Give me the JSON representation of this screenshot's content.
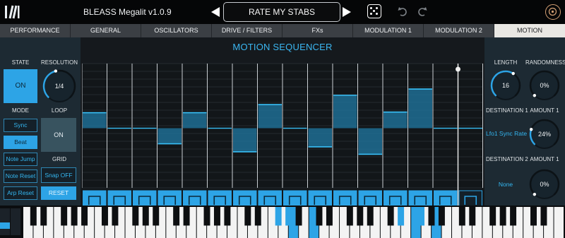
{
  "app": {
    "title": "BLEASS Megalit  v1.0.9",
    "preset_name": "RATE MY STABS"
  },
  "tabs": [
    {
      "label": "PERFORMANCE",
      "active": false
    },
    {
      "label": "GENERAL",
      "active": false
    },
    {
      "label": "OSCILLATORS",
      "active": false
    },
    {
      "label": "DRIVE / FILTERS",
      "active": false
    },
    {
      "label": "FXs",
      "active": false
    },
    {
      "label": "MODULATION 1",
      "active": false
    },
    {
      "label": "MODULATION 2",
      "active": false
    },
    {
      "label": "MOTION",
      "active": true
    }
  ],
  "left": {
    "state_label": "STATE",
    "state_value": "ON",
    "resolution_label": "RESOLUTION",
    "resolution_value": "1/4",
    "resolution_level": 0.45,
    "mode_label": "MODE",
    "modes": [
      {
        "label": "Sync",
        "selected": false
      },
      {
        "label": "Beat",
        "selected": true
      },
      {
        "label": "Note Jump",
        "selected": false
      },
      {
        "label": "Note Reset",
        "selected": false
      },
      {
        "label": "Arp Reset",
        "selected": false
      }
    ],
    "loop_label": "LOOP",
    "loop_value": "ON",
    "grid_label": "GRID",
    "snap_label": "Snap OFF",
    "reset_label": "RESET"
  },
  "sequencer": {
    "title": "MOTION SEQUENCER",
    "steps": [
      0.25,
      0.0,
      0.0,
      -0.25,
      0.25,
      0.0,
      -0.38,
      0.38,
      0.0,
      -0.3,
      0.53,
      -0.42,
      0.26,
      0.63,
      0.0,
      0.0
    ],
    "step_buttons_active": [
      true,
      true,
      true,
      true,
      true,
      true,
      true,
      true,
      true,
      true,
      true,
      true,
      true,
      true,
      true,
      false
    ]
  },
  "right": {
    "length_label": "LENGTH",
    "length_value": "16",
    "length_level": 0.62,
    "randomness_label": "RANDOMNESS",
    "randomness_value": "0%",
    "randomness_level": 0.0,
    "dest1_label": "DESTINATION 1",
    "dest1_value": "Lfo1 Sync Rate",
    "amount1_label": "AMOUNT 1",
    "amount1_value": "24%",
    "amount1_level": 0.24,
    "dest2_label": "DESTINATION 2",
    "dest2_value": "None",
    "amount2_label": "AMOUNT 1",
    "amount2_value": "0%",
    "amount2_level": 0.0
  },
  "colors": {
    "accent": "#2da4e6",
    "accent_text": "#34b6f0",
    "panel": "#1d2a33",
    "tab_bar": "#3b3f44",
    "active_tab": "#e9e7e3"
  },
  "keyboard": {
    "highlighted_white_keys": [
      26,
      28,
      38,
      40
    ],
    "highlighted_black_keys": [
      17,
      18,
      26,
      27
    ]
  },
  "icons": [
    "bleass-logo-icon",
    "prev-preset-icon",
    "next-preset-icon",
    "dice-icon",
    "undo-icon",
    "redo-icon",
    "megalit-logo-icon"
  ]
}
